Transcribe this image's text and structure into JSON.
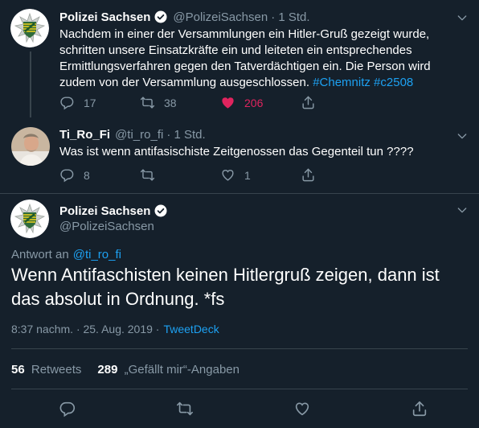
{
  "tweet1": {
    "name": "Polizei Sachsen",
    "handle": "@PolizeiSachsen",
    "time": "· 1 Std.",
    "text": "Nachdem in einer der Versammlungen ein Hitler-Gruß gezeigt wurde, schritten unsere Einsatzkräfte ein und leiteten ein entsprechendes Ermittlungsverfahren gegen den Tatverdächtigen ein. Die Person wird zudem von der Versammlung ausgeschlossen.",
    "hashtags": "#Chemnitz #c2508",
    "replies": "17",
    "retweets": "38",
    "likes": "206"
  },
  "tweet2": {
    "name": "Ti_Ro_Fi",
    "handle": "@ti_ro_fi",
    "time": "· 1 Std.",
    "text": "Was ist wenn antifasischiste Zeitgenossen das Gegenteil tun ????",
    "replies": "8",
    "retweets": "",
    "likes": "1"
  },
  "main": {
    "name": "Polizei Sachsen",
    "handle": "@PolizeiSachsen",
    "reply_prefix": "Antwort an",
    "reply_to": "@ti_ro_fi",
    "text": "Wenn Antifaschisten keinen Hitlergruß zeigen, dann ist das absolut in Ordnung. *fs",
    "timestamp": "8:37 nachm. · 25. Aug. 2019 ·",
    "source": "TweetDeck",
    "retweet_count": "56",
    "retweet_label": "Retweets",
    "like_count": "289",
    "like_label": "„Gefällt mir“-Angaben"
  },
  "colors": {
    "background": "#15202b",
    "accent": "#1da1f2",
    "like": "#e0245e",
    "muted": "#8899a6"
  }
}
